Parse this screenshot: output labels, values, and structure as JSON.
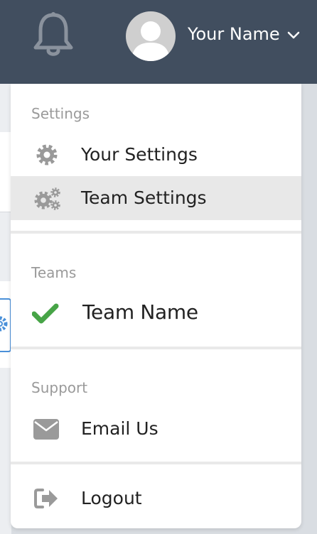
{
  "header": {
    "user_name": "Your Name",
    "icons": {
      "notifications": "bell-icon",
      "avatar": "user-avatar",
      "menu_toggle": "chevron-down-icon"
    },
    "colors": {
      "navbar_bg": "#414e5f",
      "navbar_text": "#ffffff"
    }
  },
  "dropdown": {
    "settings": {
      "header": "Settings",
      "items": [
        {
          "label": "Your Settings",
          "icon": "gear-icon",
          "active": false
        },
        {
          "label": "Team Settings",
          "icon": "gears-icon",
          "active": true
        }
      ]
    },
    "teams": {
      "header": "Teams",
      "items": [
        {
          "label": "Team Name",
          "icon": "check-icon",
          "selected": true
        }
      ]
    },
    "support": {
      "header": "Support",
      "items": [
        {
          "label": "Email Us",
          "icon": "envelope-icon"
        }
      ]
    },
    "logout": {
      "label": "Logout",
      "icon": "sign-out-icon"
    },
    "colors": {
      "active_item_bg": "#e8e8e8",
      "check_color": "#47a447",
      "icon_color": "#9a9a9a",
      "section_header_color": "#9a9a9a"
    }
  }
}
